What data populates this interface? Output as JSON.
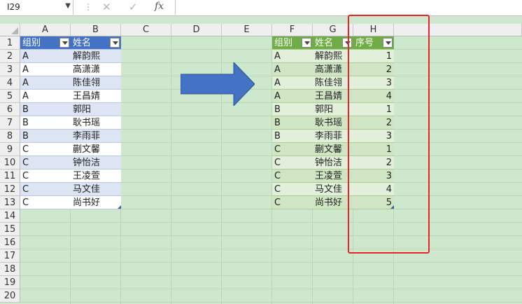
{
  "name_box": {
    "value": "I29",
    "dropdown_glyph": "▼"
  },
  "formula_bar": {
    "cancel_glyph": "✕",
    "enter_glyph": "✓",
    "fx_label": "fx",
    "value": ""
  },
  "columns": [
    "A",
    "B",
    "C",
    "D",
    "E",
    "F",
    "G",
    "H"
  ],
  "rows": [
    "1",
    "2",
    "3",
    "4",
    "5",
    "6",
    "7",
    "8",
    "9",
    "10",
    "11",
    "12",
    "13",
    "14",
    "15",
    "16",
    "17",
    "18",
    "19",
    "20"
  ],
  "source_table": {
    "headers": [
      "组别",
      "姓名"
    ],
    "rows": [
      [
        "A",
        "解韵熙"
      ],
      [
        "A",
        "高潇潇"
      ],
      [
        "A",
        "陈佳翎"
      ],
      [
        "A",
        "王昌婧"
      ],
      [
        "B",
        "郭阳"
      ],
      [
        "B",
        "耿书瑶"
      ],
      [
        "B",
        "李雨菲"
      ],
      [
        "C",
        "蒯文馨"
      ],
      [
        "C",
        "钟怡洁"
      ],
      [
        "C",
        "王凌萱"
      ],
      [
        "C",
        "马文佳"
      ],
      [
        "C",
        "尚书好"
      ]
    ]
  },
  "result_table": {
    "headers": [
      "组别",
      "姓名",
      "序号"
    ],
    "rows": [
      [
        "A",
        "解韵熙",
        "1"
      ],
      [
        "A",
        "高潇潇",
        "2"
      ],
      [
        "A",
        "陈佳翎",
        "3"
      ],
      [
        "A",
        "王昌婧",
        "4"
      ],
      [
        "B",
        "郭阳",
        "1"
      ],
      [
        "B",
        "耿书瑶",
        "2"
      ],
      [
        "B",
        "李雨菲",
        "3"
      ],
      [
        "C",
        "蒯文馨",
        "1"
      ],
      [
        "C",
        "钟怡洁",
        "2"
      ],
      [
        "C",
        "王凌萱",
        "3"
      ],
      [
        "C",
        "马文佳",
        "4"
      ],
      [
        "C",
        "尚书好",
        "5"
      ]
    ]
  },
  "colors": {
    "source_header": "#4472c4",
    "result_header": "#70ad47",
    "arrow": "#4472c4",
    "highlight": "#e8242b"
  }
}
